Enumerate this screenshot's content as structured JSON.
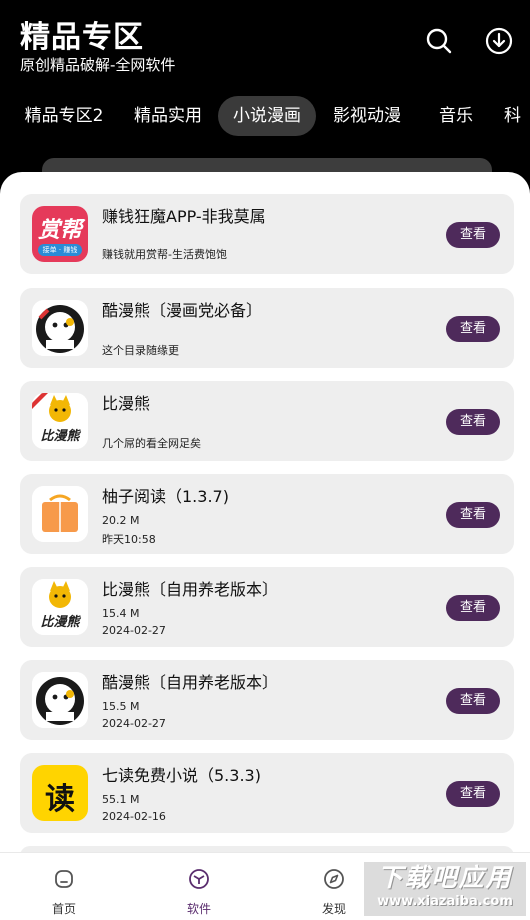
{
  "header": {
    "title": "精品专区",
    "subtitle": "原创精品破解-全网软件"
  },
  "tabs": [
    "精品专区2",
    "精品实用",
    "小说漫画",
    "影视动漫",
    "音乐",
    "科"
  ],
  "apps": [
    {
      "name": "赚钱狂魔APP-非我莫属",
      "line1": "赚钱就用赏帮-生活费饱饱",
      "line2": "",
      "icon": "shangbang-app-icon",
      "icon_text": "赏帮",
      "icon_sub": "接单 · 赚钱"
    },
    {
      "name": "酷漫熊〔漫画党必备〕",
      "line1": "这个目录随缘更",
      "line2": "",
      "icon": "kumanxiong-app-icon"
    },
    {
      "name": "比漫熊",
      "line1": "几个屌的看全网足矣",
      "line2": "",
      "icon": "bimanxiong-app-icon",
      "icon_text": "比漫熊"
    },
    {
      "name": "柚子阅读（1.3.7)",
      "line1": "20.2 M",
      "line2": "昨天10:58",
      "icon": "youzi-book-icon"
    },
    {
      "name": "比漫熊〔自用养老版本〕",
      "line1": "15.4 M",
      "line2": "2024-02-27",
      "icon": "bimanxiong-app-icon",
      "icon_text": "比漫熊"
    },
    {
      "name": "酷漫熊〔自用养老版本〕",
      "line1": "15.5 M",
      "line2": "2024-02-27",
      "icon": "kumanxiong-app-icon"
    },
    {
      "name": "七读免费小说（5.3.3)",
      "line1": "55.1 M",
      "line2": "2024-02-16",
      "icon": "qidu-app-icon",
      "icon_text": "读"
    }
  ],
  "view_label": "查看",
  "nav": [
    {
      "label": "首页",
      "icon": "home-icon"
    },
    {
      "label": "软件",
      "icon": "cube-icon"
    },
    {
      "label": "发现",
      "icon": "compass-icon"
    }
  ],
  "watermark": {
    "big": "下载吧应用",
    "small": "www.xiazaiba.com"
  },
  "colors": {
    "accent": "#4e2a5b",
    "background": "#000000",
    "card": "#eeeeee"
  }
}
